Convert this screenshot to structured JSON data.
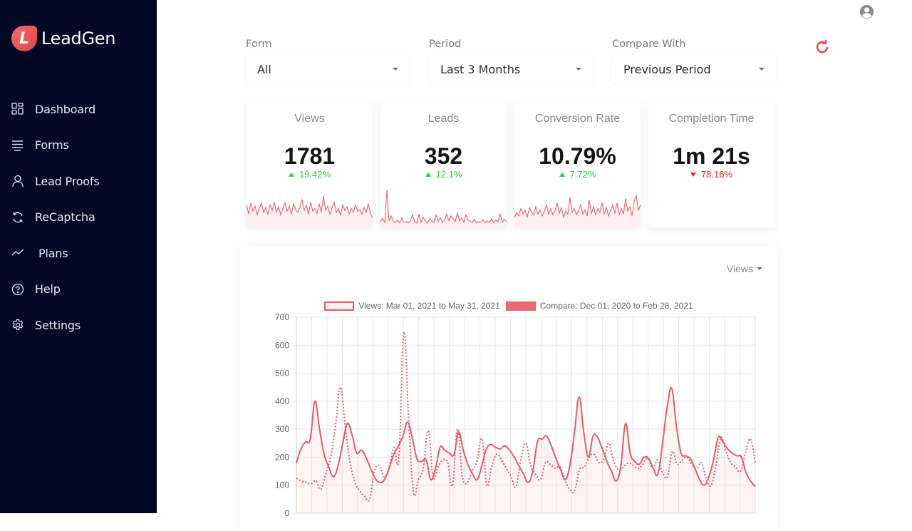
{
  "app": {
    "name": "LeadGen",
    "logo_letter": "L"
  },
  "sidebar": {
    "items": [
      {
        "label": "Dashboard",
        "icon": "dashboard-grid-icon"
      },
      {
        "label": "Forms",
        "icon": "list-lines-icon"
      },
      {
        "label": "Lead Proofs",
        "icon": "user-icon"
      },
      {
        "label": "ReCaptcha",
        "icon": "refresh-cycle-icon"
      },
      {
        "label": "Plans",
        "icon": "trend-line-icon"
      },
      {
        "label": "Help",
        "icon": "question-circle-icon"
      },
      {
        "label": "Settings",
        "icon": "gear-icon"
      }
    ]
  },
  "header": {
    "user_icon": "account-circle-icon",
    "refresh_icon": "refresh-icon"
  },
  "filters": {
    "form": {
      "label": "Form",
      "value": "All"
    },
    "period": {
      "label": "Period",
      "value": "Last 3 Months"
    },
    "compare": {
      "label": "Compare With",
      "value": "Previous Period"
    }
  },
  "colors": {
    "sidebar_bg": "#020824",
    "accent": "#e35d67",
    "up": "#2ecc40",
    "down": "#e02424"
  },
  "stats": [
    {
      "title": "Views",
      "value": "1781",
      "delta": "19.42%",
      "direction": "up",
      "spark": [
        55,
        30,
        60,
        38,
        52,
        28,
        45,
        60,
        35,
        48,
        30,
        55,
        40,
        62,
        35,
        50,
        28,
        45,
        60,
        38,
        52,
        30,
        58,
        42,
        35,
        48,
        70,
        40,
        55,
        30,
        62,
        38,
        45,
        32,
        58,
        35,
        80,
        40,
        52,
        30,
        48,
        62,
        35,
        45,
        28,
        55,
        40,
        50,
        30,
        46,
        35,
        55,
        38,
        42,
        30,
        48,
        35,
        58,
        32,
        20
      ]
    },
    {
      "title": "Leads",
      "value": "352",
      "delta": "12.1%",
      "direction": "up",
      "spark": [
        10,
        18,
        8,
        95,
        12,
        25,
        10,
        8,
        14,
        6,
        20,
        8,
        10,
        6,
        12,
        28,
        10,
        6,
        30,
        8,
        22,
        10,
        6,
        18,
        12,
        8,
        28,
        10,
        20,
        8,
        14,
        30,
        12,
        26,
        18,
        10,
        34,
        12,
        20,
        8,
        28,
        14,
        10,
        8,
        16,
        6,
        10,
        8,
        14,
        6,
        12,
        8,
        18,
        6,
        14,
        10,
        30,
        8,
        16,
        10
      ]
    },
    {
      "title": "Conversion Rate",
      "value": "10.79%",
      "delta": "7.72%",
      "direction": "up",
      "spark": [
        20,
        35,
        25,
        45,
        30,
        40,
        22,
        48,
        35,
        28,
        50,
        30,
        42,
        25,
        38,
        55,
        30,
        45,
        28,
        40,
        60,
        32,
        48,
        22,
        38,
        30,
        75,
        35,
        45,
        28,
        40,
        55,
        30,
        42,
        25,
        68,
        30,
        50,
        28,
        45,
        35,
        62,
        30,
        48,
        25,
        40,
        55,
        32,
        60,
        28,
        45,
        30,
        72,
        38,
        50,
        25,
        65,
        80,
        40,
        55
      ]
    },
    {
      "title": "Completion Time",
      "value": "1m 21s",
      "delta": "78.16%",
      "direction": "down",
      "spark": []
    }
  ],
  "chart_panel": {
    "metric_selector": "Views"
  },
  "chart_data": {
    "type": "line",
    "title": "",
    "xlabel": "",
    "ylabel": "",
    "ylim": [
      0,
      700
    ],
    "yticks": [
      0,
      100,
      200,
      300,
      400,
      500,
      600,
      700
    ],
    "grid": true,
    "legend_position": "top",
    "series": [
      {
        "name": "Views: Mar 01, 2021 to May 31, 2021",
        "style": "solid-filled",
        "values": [
          180,
          230,
          255,
          265,
          400,
          300,
          210,
          165,
          130,
          170,
          250,
          320,
          280,
          215,
          225,
          200,
          160,
          125,
          110,
          120,
          160,
          210,
          240,
          275,
          325,
          270,
          195,
          185,
          190,
          120,
          160,
          235,
          225,
          215,
          210,
          290,
          225,
          175,
          140,
          120,
          170,
          230,
          245,
          235,
          230,
          240,
          225,
          200,
          170,
          140,
          110,
          150,
          255,
          265,
          275,
          240,
          195,
          155,
          120,
          170,
          290,
          415,
          290,
          200,
          275,
          270,
          230,
          185,
          150,
          115,
          170,
          320,
          215,
          185,
          175,
          200,
          195,
          160,
          140,
          250,
          380,
          445,
          310,
          215,
          205,
          195,
          160,
          120,
          100,
          130,
          190,
          270,
          255,
          230,
          215,
          205,
          200,
          145,
          115,
          95
        ]
      },
      {
        "name": "Compare: Dec 01, 2020 to Feb 28, 2021",
        "style": "dotted",
        "values": [
          125,
          115,
          110,
          105,
          115,
          85,
          140,
          200,
          310,
          450,
          310,
          180,
          110,
          80,
          60,
          50,
          150,
          170,
          130,
          165,
          235,
          200,
          645,
          330,
          75,
          120,
          160,
          295,
          130,
          165,
          190,
          180,
          100,
          300,
          130,
          110,
          150,
          185,
          265,
          100,
          165,
          210,
          190,
          160,
          130,
          95,
          195,
          250,
          170,
          140,
          120,
          180,
          175,
          160,
          165,
          120,
          85,
          80,
          155,
          165,
          200,
          210,
          180,
          195,
          250,
          185,
          155,
          165,
          180,
          170,
          160,
          175,
          195,
          160,
          190,
          145,
          130,
          220,
          175,
          190,
          200,
          175,
          160,
          180,
          120,
          100,
          175,
          270,
          220,
          180,
          165,
          150,
          215,
          265,
          180
        ]
      }
    ],
    "x_points": 92
  }
}
